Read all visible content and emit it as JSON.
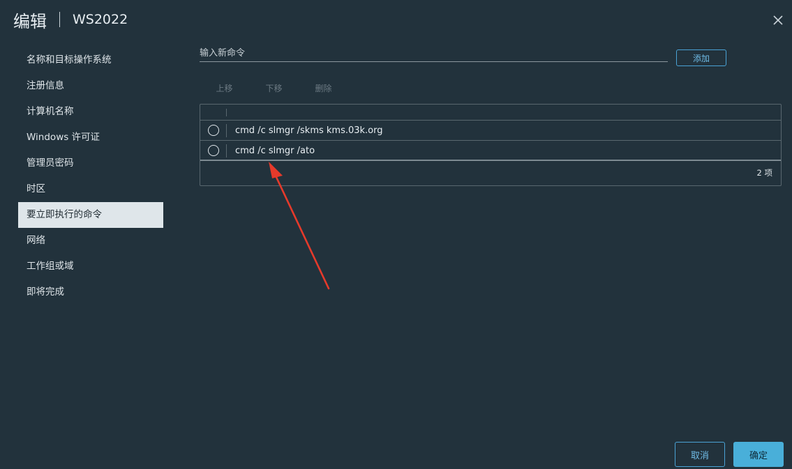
{
  "dialog": {
    "title": "编辑",
    "subtitle": "WS2022"
  },
  "sidebar": {
    "items": [
      {
        "label": "名称和目标操作系统",
        "active": false
      },
      {
        "label": "注册信息",
        "active": false
      },
      {
        "label": "计算机名称",
        "active": false
      },
      {
        "label": "Windows 许可证",
        "active": false
      },
      {
        "label": "管理员密码",
        "active": false
      },
      {
        "label": "时区",
        "active": false
      },
      {
        "label": "要立即执行的命令",
        "active": true
      },
      {
        "label": "网络",
        "active": false
      },
      {
        "label": "工作组或域",
        "active": false
      },
      {
        "label": "即将完成",
        "active": false
      }
    ]
  },
  "command_input": {
    "value": "",
    "placeholder": "输入新命令"
  },
  "add_button": "添加",
  "toolbar": {
    "move_up": "上移",
    "move_down": "下移",
    "delete": "删除"
  },
  "commands": {
    "rows": [
      {
        "text": "cmd /c slmgr /skms kms.03k.org",
        "selected": false
      },
      {
        "text": "cmd /c slmgr /ato",
        "selected": false
      }
    ],
    "footer": "2 项"
  },
  "footer": {
    "cancel": "取消",
    "ok": "确定"
  },
  "colors": {
    "background": "#22323c",
    "accent": "#49afd9",
    "annotation_arrow": "#e53a2b"
  },
  "icons": {
    "close": "close-icon",
    "annotation": "red-arrow-annotation"
  }
}
